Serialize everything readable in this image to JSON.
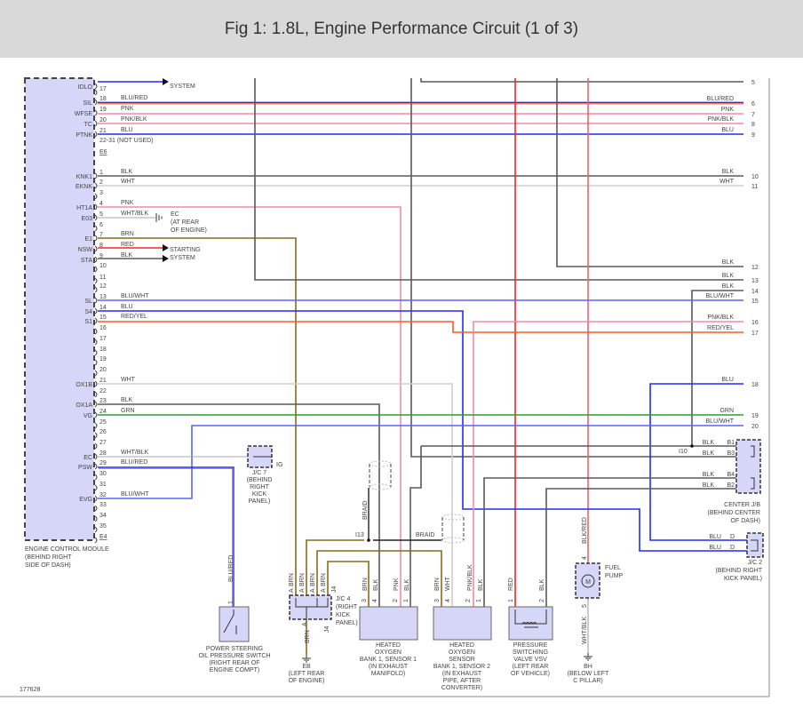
{
  "title": "Fig 1: 1.8L, Engine Performance Circuit (1 of 3)",
  "figure_number": "177628",
  "wire_colors": {
    "BLK": "#5a5a5a",
    "WHT": "#cfcfcf",
    "PNK": "#f48ca4",
    "BLU": "#1f2cff",
    "BLUWHT": "#5a62ff",
    "BRN": "#8a6a1c",
    "RED": "#ff2020",
    "GRN": "#2aa02a",
    "REDYEL": "#ff5a1e",
    "BRAID": "#222222",
    "ECM_FILL": "#d6d6f8"
  },
  "ecm": {
    "name": [
      "ENGINE CONTROL MODULE",
      "(BEHIND RIGHT",
      "SIDE OF DASH)"
    ],
    "pins": [
      {
        "num": "",
        "term": "IDLO",
        "wire": ""
      },
      {
        "num": "17",
        "term": "",
        "wire": ""
      },
      {
        "num": "18",
        "term": "SIL",
        "wire": "BLU/RED"
      },
      {
        "num": "19",
        "term": "WFSE",
        "wire": "PNK"
      },
      {
        "num": "20",
        "term": "TC",
        "wire": "PNK/BLK"
      },
      {
        "num": "21",
        "term": "PTNK",
        "wire": "BLU"
      },
      {
        "num": "22-31 (NOT USED)",
        "term": "",
        "wire": ""
      },
      {
        "num": "E6",
        "term": "",
        "wire": ""
      },
      {
        "num": "1",
        "term": "KNK1",
        "wire": "BLK"
      },
      {
        "num": "2",
        "term": "EKNK",
        "wire": "WHT"
      },
      {
        "num": "3",
        "term": "",
        "wire": ""
      },
      {
        "num": "4",
        "term": "HT1A",
        "wire": "PNK"
      },
      {
        "num": "5",
        "term": "E03",
        "wire": "WHT/BLK"
      },
      {
        "num": "6",
        "term": "",
        "wire": ""
      },
      {
        "num": "7",
        "term": "E1",
        "wire": "BRN"
      },
      {
        "num": "8",
        "term": "NSW",
        "wire": "RED"
      },
      {
        "num": "9",
        "term": "STA",
        "wire": "BLK"
      },
      {
        "num": "10",
        "term": "",
        "wire": ""
      },
      {
        "num": "11",
        "term": "",
        "wire": ""
      },
      {
        "num": "12",
        "term": "",
        "wire": ""
      },
      {
        "num": "13",
        "term": "SL",
        "wire": "BLU/WHT"
      },
      {
        "num": "14",
        "term": "S4",
        "wire": "BLU"
      },
      {
        "num": "15",
        "term": "S1",
        "wire": "RED/YEL"
      },
      {
        "num": "16",
        "term": "",
        "wire": ""
      },
      {
        "num": "17",
        "term": "",
        "wire": ""
      },
      {
        "num": "18",
        "term": "",
        "wire": ""
      },
      {
        "num": "19",
        "term": "",
        "wire": ""
      },
      {
        "num": "20",
        "term": "",
        "wire": ""
      },
      {
        "num": "21",
        "term": "OX1B",
        "wire": "WHT"
      },
      {
        "num": "22",
        "term": "",
        "wire": ""
      },
      {
        "num": "23",
        "term": "OX1A",
        "wire": "BLK"
      },
      {
        "num": "24",
        "term": "VG",
        "wire": "GRN"
      },
      {
        "num": "25",
        "term": "",
        "wire": ""
      },
      {
        "num": "26",
        "term": "",
        "wire": ""
      },
      {
        "num": "27",
        "term": "",
        "wire": ""
      },
      {
        "num": "28",
        "term": "EC",
        "wire": "WHT/BLK"
      },
      {
        "num": "29",
        "term": "PSW",
        "wire": "BLU/RED"
      },
      {
        "num": "30",
        "term": "",
        "wire": ""
      },
      {
        "num": "31",
        "term": "",
        "wire": ""
      },
      {
        "num": "32",
        "term": "EVG",
        "wire": "BLU/WHT"
      },
      {
        "num": "33",
        "term": "",
        "wire": ""
      },
      {
        "num": "34",
        "term": "",
        "wire": ""
      },
      {
        "num": "35",
        "term": "",
        "wire": ""
      },
      {
        "num": "E4",
        "term": "",
        "wire": ""
      }
    ]
  },
  "right_pins": [
    {
      "num": "5",
      "wire": ""
    },
    {
      "num": "6",
      "wire": "BLU/RED"
    },
    {
      "num": "7",
      "wire": "PNK"
    },
    {
      "num": "8",
      "wire": "PNK/BLK"
    },
    {
      "num": "9",
      "wire": "BLU"
    },
    {
      "num": "10",
      "wire": "BLK"
    },
    {
      "num": "11",
      "wire": "WHT"
    },
    {
      "num": "12",
      "wire": "BLK"
    },
    {
      "num": "13",
      "wire": "BLK"
    },
    {
      "num": "14",
      "wire": "BLK"
    },
    {
      "num": "15",
      "wire": "BLU/WHT"
    },
    {
      "num": "16",
      "wire": "PNK/BLK"
    },
    {
      "num": "17",
      "wire": "RED/YEL"
    },
    {
      "num": "18",
      "wire": "BLU"
    },
    {
      "num": "19",
      "wire": "GRN"
    },
    {
      "num": "20",
      "wire": "BLU/WHT"
    }
  ],
  "labels": {
    "idle_system": [
      "SYSTEM"
    ],
    "ec_ground": [
      "EC",
      "(AT REAR",
      "OF ENGINE)"
    ],
    "starting_system": [
      "STARTING",
      "SYSTEM"
    ],
    "jc7": [
      "J/C 7",
      "(BEHIND",
      "RIGHT",
      "KICK",
      "PANEL)"
    ],
    "ig": [
      "IG"
    ],
    "center_jb": [
      "CENTER J/B",
      "(BEHIND CENTER",
      "OF DASH)"
    ],
    "center_jb_pins": [
      "BLK",
      "B1",
      "BLK",
      "B3",
      "BLK",
      "B4",
      "BLK",
      "B2"
    ],
    "i10": [
      "I10"
    ],
    "jc2": [
      "J/C 2",
      "(BEHIND RIGHT",
      "KICK PANEL)"
    ],
    "jc2_pins": [
      "BLU",
      "D",
      "BLU",
      "D"
    ],
    "ps_switch": [
      "POWER STEERING",
      "OIL PRESSURE SWITCH",
      "(RIGHT REAR OF",
      "ENGINE COMPT)"
    ],
    "jc4": [
      "J/C 4",
      "(RIGHT",
      "KICK",
      "PANEL)"
    ],
    "eb": [
      "EB",
      "(LEFT REAR",
      "OF ENGINE)"
    ],
    "o2s1": [
      "HEATED",
      "OXYGEN",
      "BANK 1, SENSOR 1",
      "(IN EXHAUST",
      "MANIFOLD)"
    ],
    "o2s2": [
      "HEATED",
      "OXYGEN",
      "SENSOR",
      "BANK 1, SENSOR 2",
      "(IN EXHAUST",
      "PIPE, AFTER",
      "CONVERTER)"
    ],
    "vsv": [
      "PRESSURE",
      "SWITCHING",
      "VALVE VSV",
      "(LEFT REAR",
      "OF VEHICLE)"
    ],
    "fuel_pump": [
      "FUEL",
      "PUMP"
    ],
    "motor": [
      "M"
    ],
    "bh": [
      "BH",
      "(BELOW LEFT",
      "C PILLAR)"
    ],
    "i13": [
      "I13"
    ],
    "braid": [
      "BRAID",
      "BRAID"
    ],
    "pin_numbers": [
      "1",
      "A",
      "A",
      "A",
      "A",
      "A",
      "3",
      "4",
      "2",
      "1",
      "3",
      "4",
      "2",
      "1",
      "1",
      "2",
      "4",
      "5"
    ],
    "vertical_wires": [
      "BLU/RED",
      "BRN",
      "BRN",
      "BRN",
      "BRN",
      "BRN",
      "BRN",
      "BLK",
      "PNK",
      "BLK",
      "BRN",
      "WHT",
      "PNK/BLK",
      "BLK",
      "RED",
      "BLK",
      "BLK/RED",
      "WHT/BLK",
      "J4",
      "J4"
    ]
  }
}
